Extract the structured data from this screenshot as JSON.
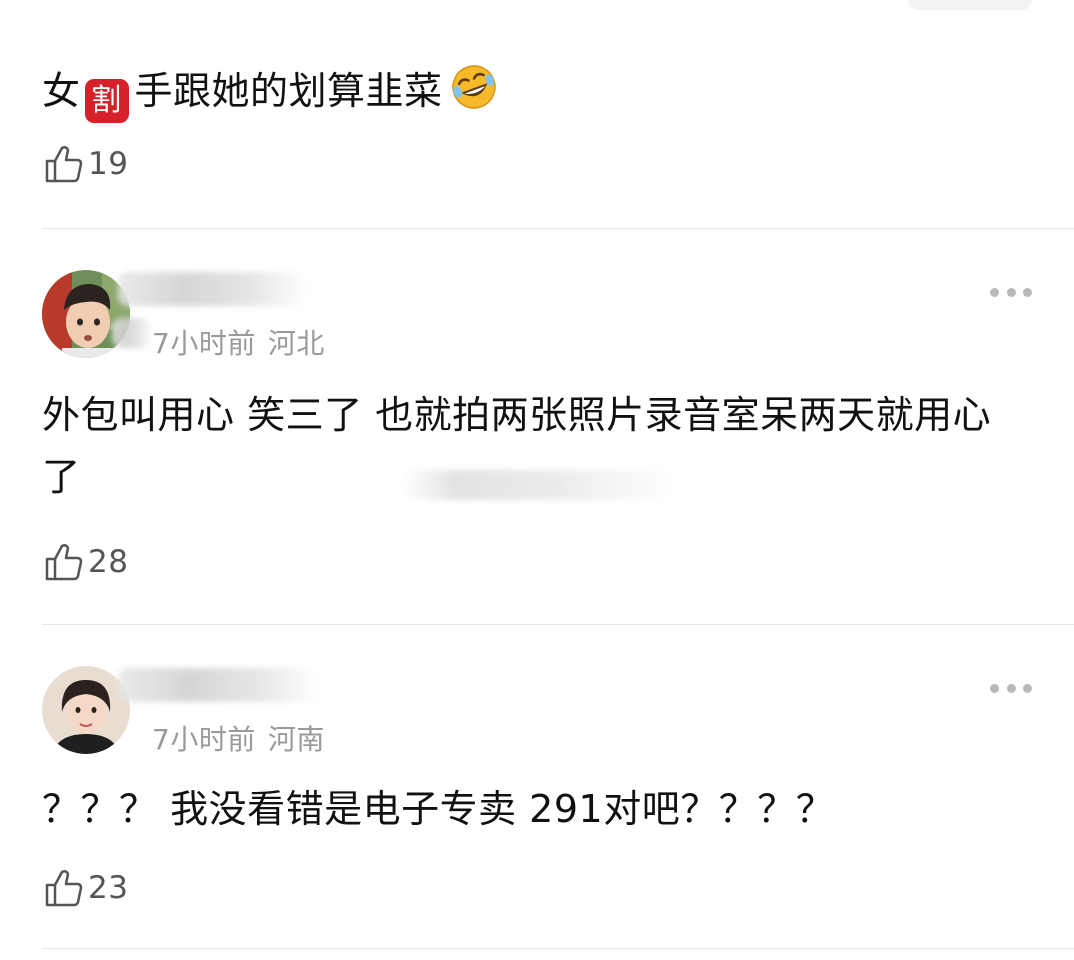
{
  "comments": [
    {
      "text_before": "女",
      "emoji_box": "割",
      "text_after": "手跟她的划算韭菜",
      "laugh_emoji": "rolling-on-floor-laughing",
      "likes": "19"
    },
    {
      "time": "7小时前",
      "location": "河北",
      "text": "外包叫用心 笑三了 也就拍两张照片录音室呆两天就用心了",
      "likes": "28"
    },
    {
      "time": "7小时前",
      "location": "河南",
      "text": "？？？ 我没看错是电子专卖 291对吧？？？？",
      "likes": "23"
    }
  ],
  "icons": {
    "like": "thumbs-up-icon",
    "more": "more-options-icon"
  },
  "colors": {
    "text": "#111111",
    "meta": "#9a9a9a",
    "like_count": "#555555",
    "divider": "#e6e6e6",
    "emoji_red": "#d6202a"
  }
}
